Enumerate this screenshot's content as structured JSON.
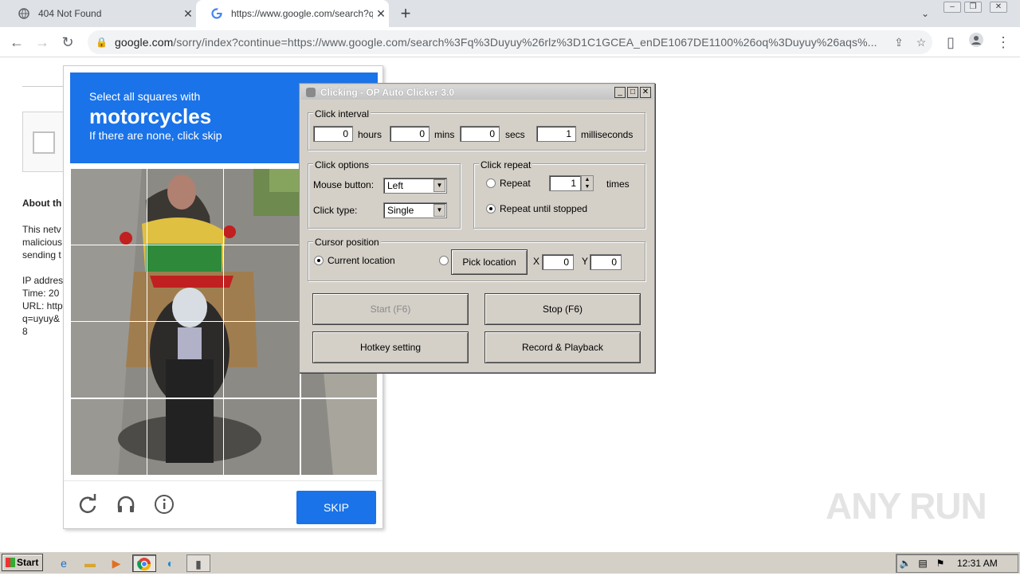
{
  "browser": {
    "tabs": [
      {
        "title": "404 Not Found",
        "active": false
      },
      {
        "title": "https://www.google.com/search?q=",
        "active": true
      }
    ],
    "new_tab": "+",
    "url_host": "google.com",
    "url_rest": "/sorry/index?continue=https://www.google.com/search%3Fq%3Duyuy%26rlz%3D1C1GCEA_enDE1067DE1100%26oq%3Duyuy%26aqs%..."
  },
  "page_behind": {
    "about": "About th",
    "body_lines": [
      "This netv",
      "malicious",
      "sending t",
      "",
      "IP addres",
      "Time: 20",
      "URL: http",
      "q=uyuy&",
      "8"
    ]
  },
  "captcha": {
    "line1": "Select all squares with",
    "target": "motorcycles",
    "line3": "If there are none, click skip",
    "skip_label": "SKIP"
  },
  "clicker": {
    "title": "Clicking - OP Auto Clicker 3.0",
    "interval": {
      "label": "Click interval",
      "hours": "0",
      "hours_label": "hours",
      "mins": "0",
      "mins_label": "mins",
      "secs": "0",
      "secs_label": "secs",
      "ms": "1",
      "ms_label": "milliseconds"
    },
    "options": {
      "label": "Click options",
      "mouse_label": "Mouse button:",
      "mouse_value": "Left",
      "type_label": "Click type:",
      "type_value": "Single"
    },
    "repeat": {
      "label": "Click repeat",
      "repeat_label": "Repeat",
      "repeat_value": "1",
      "times_label": "times",
      "until_label": "Repeat until stopped"
    },
    "cursor": {
      "label": "Cursor position",
      "current_label": "Current location",
      "pick_label": "Pick location",
      "x_label": "X",
      "x_value": "0",
      "y_label": "Y",
      "y_value": "0"
    },
    "buttons": {
      "start": "Start (F6)",
      "stop": "Stop (F6)",
      "hotkey": "Hotkey setting",
      "record": "Record & Playback"
    }
  },
  "watermark": "ANY RUN",
  "taskbar": {
    "start": "Start",
    "clock": "12:31 AM"
  }
}
